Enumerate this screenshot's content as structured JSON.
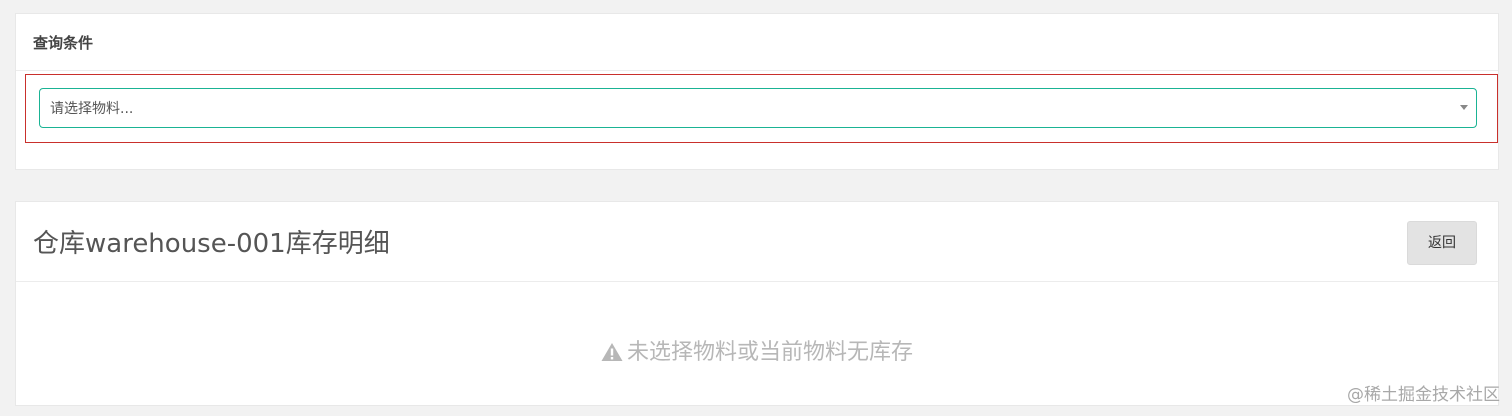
{
  "query_panel": {
    "title": "查询条件",
    "material_select": {
      "placeholder": "请选择物料..."
    }
  },
  "detail_panel": {
    "title": "仓库warehouse-001库存明细",
    "back_button_label": "返回",
    "empty_message": "未选择物料或当前物料无库存"
  },
  "watermark": "@稀土掘金技术社区",
  "colors": {
    "select_border": "#1ab394",
    "highlight_border": "#c9302c",
    "empty_text": "#b7b7b7",
    "background": "#f2f2f2"
  },
  "icons": {
    "empty_message_icon": "warning-icon",
    "select_arrow_icon": "caret-down-icon"
  }
}
